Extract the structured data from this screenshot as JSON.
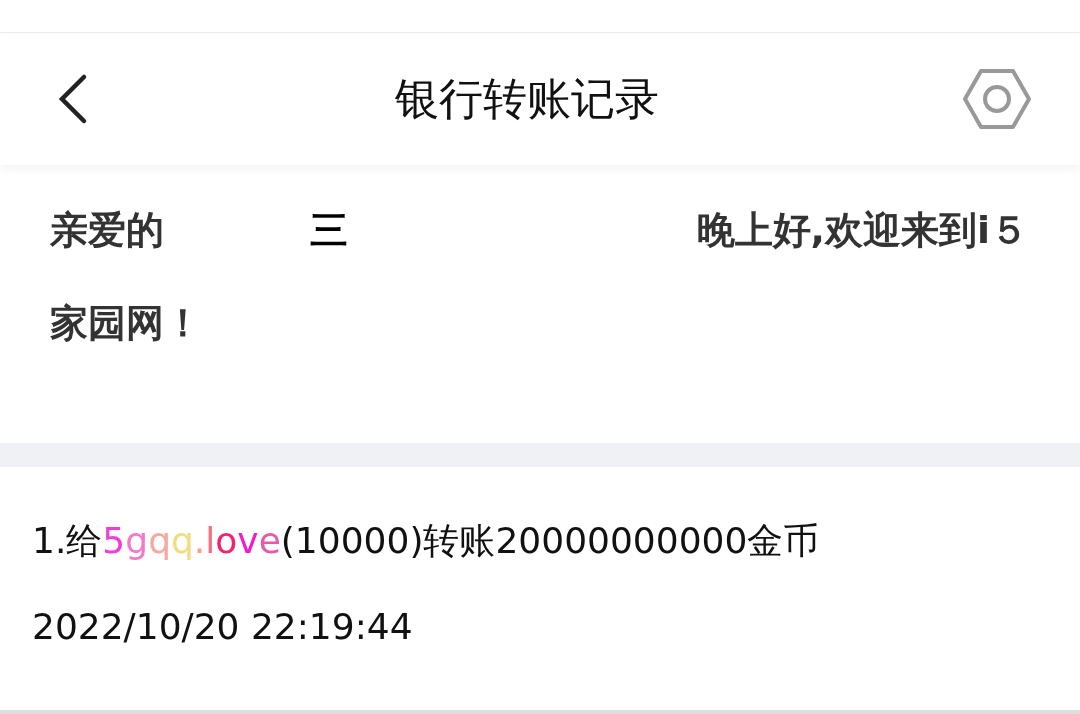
{
  "header": {
    "title": "银行转账记录"
  },
  "greeting": {
    "salutation": "亲爱的",
    "username": "三",
    "line1_end": "晚上好,欢迎来到i５",
    "line2": "家园网！"
  },
  "records": [
    {
      "prefix": "1.给",
      "name_letters": [
        {
          "text": "5",
          "color": "#f03cd8"
        },
        {
          "text": "g",
          "color": "#f27ac8"
        },
        {
          "text": "q",
          "color": "#f5a9a0"
        },
        {
          "text": "q",
          "color": "#f2dc80"
        },
        {
          "text": ".",
          "color": "#f5a080"
        },
        {
          "text": "l",
          "color": "#f76e7e"
        },
        {
          "text": "o",
          "color": "#f5206e"
        },
        {
          "text": "v",
          "color": "#f01ec8"
        },
        {
          "text": "e",
          "color": "#e65aa8"
        }
      ],
      "suffix": "(10000)转账20000000000金币",
      "time": "2022/10/20 22:19:44"
    }
  ]
}
